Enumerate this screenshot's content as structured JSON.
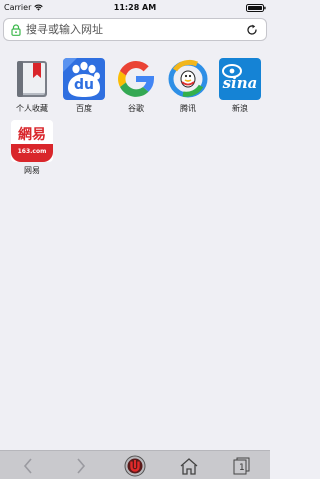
{
  "status_bar": {
    "carrier": "Carrier",
    "time": "11:28 AM"
  },
  "address_bar": {
    "placeholder": "搜寻或输入网址"
  },
  "bookmarks": [
    {
      "label": "个人收藏",
      "icon": "bookmark-book-icon"
    },
    {
      "label": "百度",
      "icon": "baidu-logo-icon"
    },
    {
      "label": "谷歌",
      "icon": "google-logo-icon"
    },
    {
      "label": "腾讯",
      "icon": "tencent-logo-icon"
    },
    {
      "label": "新浪",
      "icon": "sina-logo-icon"
    },
    {
      "label": "网易",
      "icon": "netease-logo-icon"
    }
  ],
  "logos": {
    "baidu_text": "du",
    "sina_text": "sina",
    "netease_text": "網易",
    "netease_subtext": "163.com"
  },
  "toolbar": {
    "tabs_count": "1"
  },
  "colors": {
    "background": "#efeff4",
    "toolbar": "#c9c9cd",
    "baidu_blue": "#2f6fe0",
    "sina_blue": "#1583d5",
    "netease_red": "#d9262b",
    "lock_green": "#3cb84b"
  }
}
